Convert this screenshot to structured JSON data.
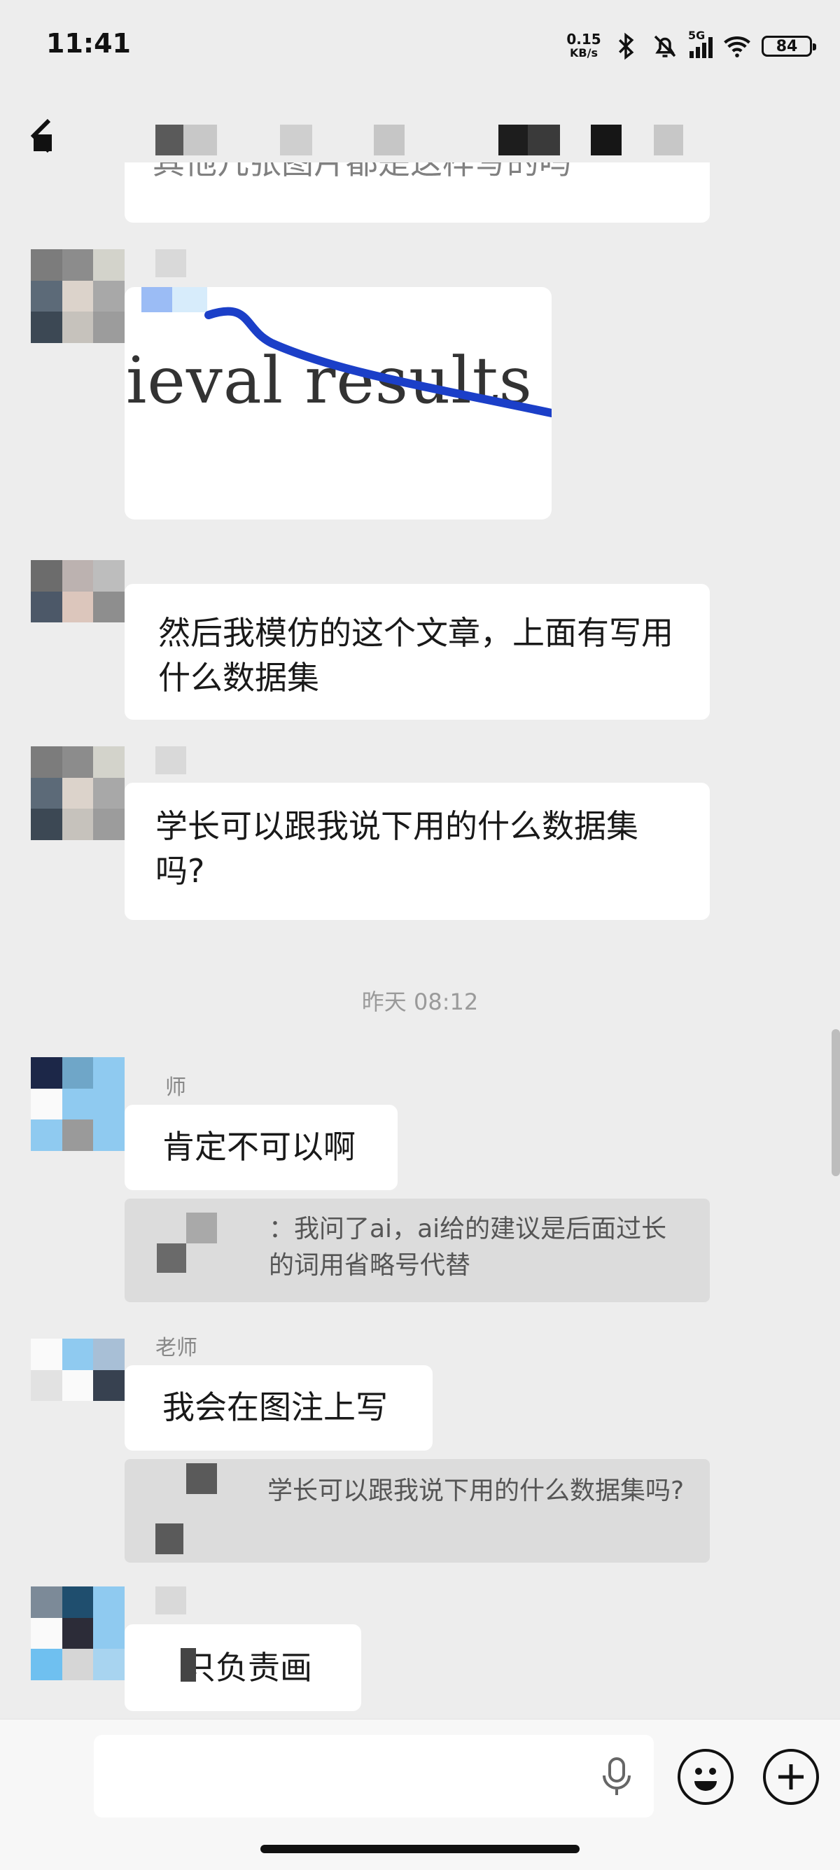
{
  "status": {
    "time": "11:41",
    "net_speed_value": "0.15",
    "net_speed_unit": "KB/s",
    "network": "5G",
    "battery": "84"
  },
  "colors": {
    "background": "#ededed",
    "bubble": "#ffffff",
    "quote": "#dcdcdc",
    "timestamp": "#9a9a9a"
  },
  "messages": {
    "m0_fragment": "其他几张图片都是这样写的吗",
    "m1_image_text": "ieval results o",
    "m2_text": "然后我模仿的这个文章，上面有写用什么数据集",
    "m3_text": "学长可以跟我说下用的什么数据集吗?",
    "timestamp": "昨天 08:12",
    "m4_sender": "师",
    "m4_text": "肯定不可以啊",
    "m4_quote": "：我问了ai，ai给的建议是后面过长的词用省略号代替",
    "m5_sender": "老师",
    "m5_text": "我会在图注上写",
    "m5_quote": "学长可以跟我说下用的什么数据集吗?",
    "m6_text": "只负责画"
  },
  "icons": {
    "back": "back-arrow-icon",
    "mic": "microphone-icon",
    "emoji": "emoji-icon",
    "plus": "plus-icon"
  }
}
